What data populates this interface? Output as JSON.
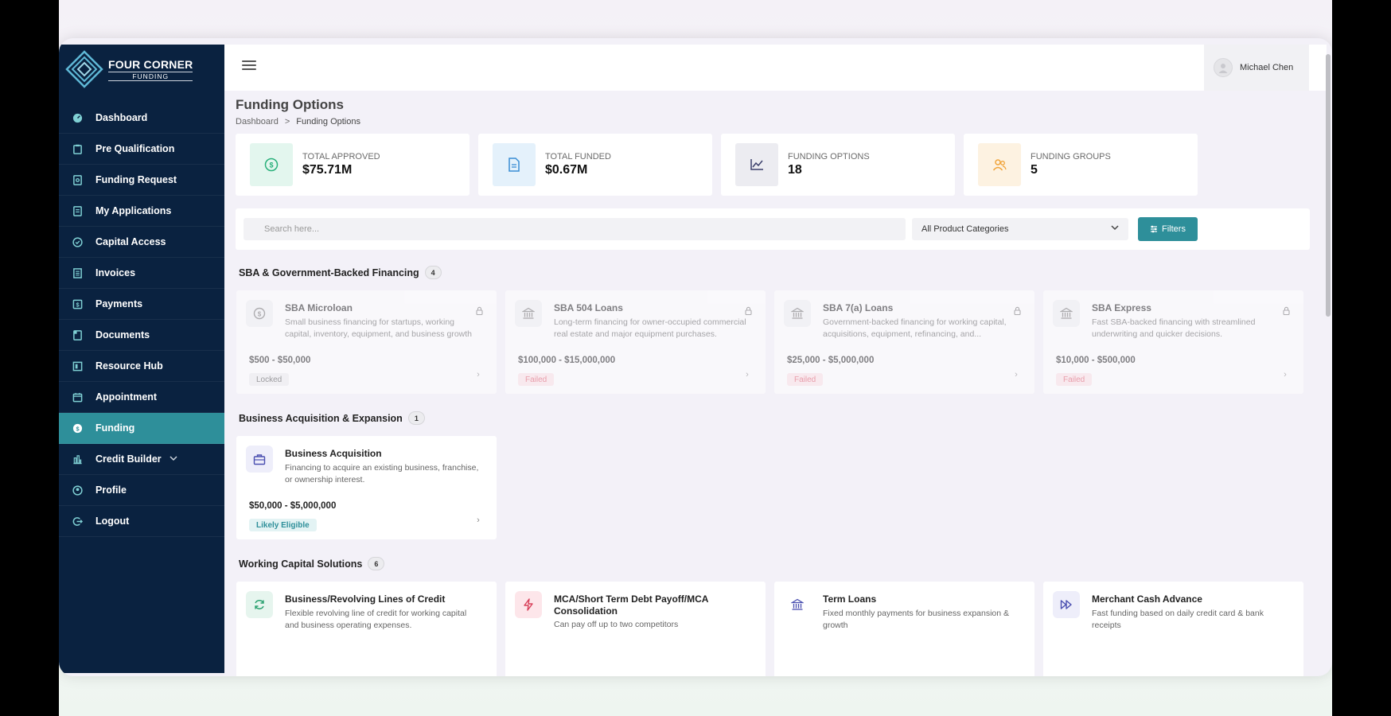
{
  "brand": {
    "name": "FOUR CORNER",
    "sub": "FUNDING"
  },
  "user": {
    "name": "Michael Chen"
  },
  "nav": [
    {
      "label": "Dashboard",
      "icon": "dashboard-icon"
    },
    {
      "label": "Pre Qualification",
      "icon": "clipboard-icon"
    },
    {
      "label": "Funding Request",
      "icon": "document-search-icon"
    },
    {
      "label": "My Applications",
      "icon": "list-icon"
    },
    {
      "label": "Capital Access",
      "icon": "check-circle-icon"
    },
    {
      "label": "Invoices",
      "icon": "invoice-icon"
    },
    {
      "label": "Payments",
      "icon": "dollar-icon"
    },
    {
      "label": "Documents",
      "icon": "folder-icon"
    },
    {
      "label": "Resource Hub",
      "icon": "book-icon"
    },
    {
      "label": "Appointment",
      "icon": "calendar-icon"
    },
    {
      "label": "Funding",
      "icon": "funding-icon"
    },
    {
      "label": "Credit Builder",
      "icon": "chart-bar-icon"
    },
    {
      "label": "Profile",
      "icon": "user-circle-icon"
    },
    {
      "label": "Logout",
      "icon": "logout-icon"
    }
  ],
  "page": {
    "title": "Funding Options",
    "breadcrumb": {
      "home": "Dashboard",
      "separator": ">",
      "current": "Funding Options"
    }
  },
  "stats": [
    {
      "label": "TOTAL APPROVED",
      "value": "$75.71M",
      "icon": "dollar-circle-icon",
      "color": "#e3f6ee"
    },
    {
      "label": "TOTAL FUNDED",
      "value": "$0.67M",
      "icon": "document-icon",
      "color": "#e4f1fb"
    },
    {
      "label": "FUNDING OPTIONS",
      "value": "18",
      "icon": "line-chart-icon",
      "color": "#ececf1"
    },
    {
      "label": "FUNDING GROUPS",
      "value": "5",
      "icon": "users-icon",
      "color": "#fdf2e1"
    }
  ],
  "search": {
    "placeholder": "Search here...",
    "value": ""
  },
  "category_select": {
    "selected": "All Product Categories"
  },
  "filters_label": "Filters",
  "sections": [
    {
      "title": "SBA & Government-Backed Financing",
      "count": "4",
      "cards": [
        {
          "title": "SBA Microloan",
          "desc": "Small business financing for startups, working capital, inventory, equipment, and business growth",
          "range": "$500 - $50,000",
          "status": "Locked"
        },
        {
          "title": "SBA 504 Loans",
          "desc": "Long-term financing for owner-occupied commercial real estate and major equipment purchases.",
          "range": "$100,000 - $15,000,000",
          "status": "Failed"
        },
        {
          "title": "SBA 7(a) Loans",
          "desc": "Government-backed financing for working capital, acquisitions, equipment, refinancing, and...",
          "range": "$25,000 - $5,000,000",
          "status": "Failed"
        },
        {
          "title": "SBA Express",
          "desc": "Fast SBA-backed financing with streamlined underwriting and quicker decisions.",
          "range": "$10,000 - $500,000",
          "status": "Failed"
        }
      ]
    },
    {
      "title": "Business Acquisition & Expansion",
      "count": "1",
      "cards": [
        {
          "title": "Business Acquisition",
          "desc": "Financing to acquire an existing business, franchise, or ownership interest.",
          "range": "$50,000 - $5,000,000",
          "status": "Likely Eligible"
        }
      ]
    },
    {
      "title": "Working Capital Solutions",
      "count": "6",
      "cards": [
        {
          "title": "Business/Revolving Lines of Credit",
          "desc": "Flexible revolving line of credit for working capital and business operating expenses."
        },
        {
          "title": "MCA/Short Term Debt Payoff/MCA Consolidation",
          "desc": "Can pay off up to two competitors"
        },
        {
          "title": "Term Loans",
          "desc": "Fixed monthly payments for business expansion & growth"
        },
        {
          "title": "Merchant Cash Advance",
          "desc": "Fast funding based on daily credit card & bank receipts"
        }
      ]
    }
  ],
  "colors": {
    "sidebar": "#0a2240",
    "accent": "#2e8f9a",
    "failed": "#e05a6c"
  }
}
